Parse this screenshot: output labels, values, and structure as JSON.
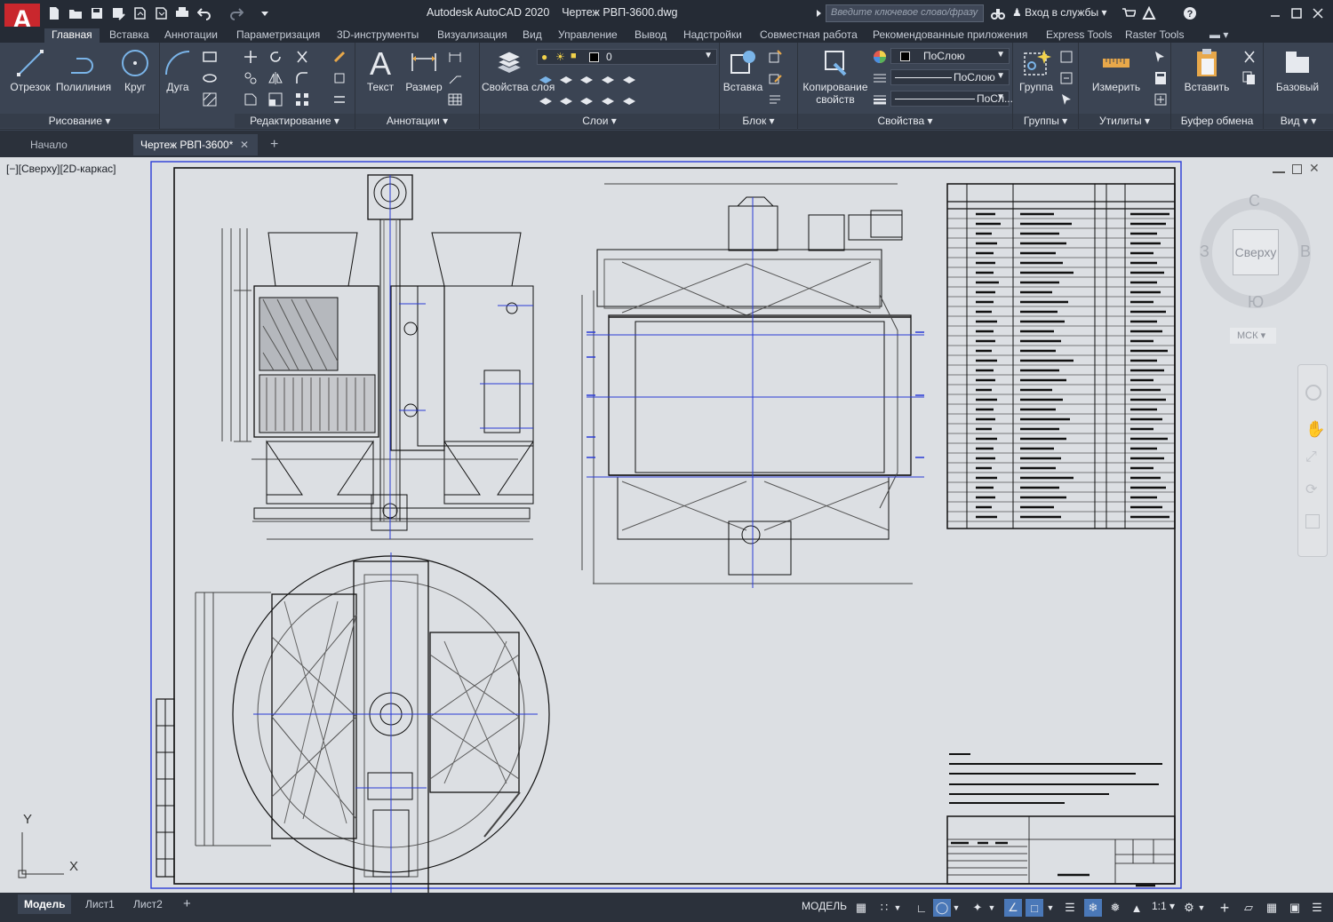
{
  "app": {
    "title": "Autodesk AutoCAD 2020",
    "drawing": "Чертеж РВП-3600.dwg",
    "logo_letter": "A"
  },
  "search": {
    "placeholder": "Введите ключевое слово/фразу"
  },
  "signin": "Вход в службы",
  "ribbon_tabs": [
    "Главная",
    "Вставка",
    "Аннотации",
    "Параметризация",
    "3D-инструменты",
    "Визуализация",
    "Вид",
    "Управление",
    "Вывод",
    "Надстройки",
    "Совместная работа",
    "Рекомендованные приложения",
    "Express Tools",
    "Raster Tools"
  ],
  "panels": {
    "draw": {
      "name": "Рисование",
      "tools": [
        "Отрезок",
        "Полилиния",
        "Круг",
        "Дуга"
      ]
    },
    "modify": {
      "name": "Редактирование"
    },
    "annotation": {
      "name": "Аннотации",
      "tools": [
        "Текст",
        "Размер"
      ]
    },
    "layers": {
      "name": "Слои",
      "tool": "Свойства слоя",
      "tool2": "слоя",
      "layer_value": "0"
    },
    "block": {
      "name": "Блок",
      "tool": "Вставка"
    },
    "properties": {
      "name": "Свойства",
      "tool": "Копирование",
      "tool2": "свойств",
      "color": "ПоСлою",
      "linetype": "ПоСлою",
      "lineweight": "ПоСл..."
    },
    "groups": {
      "name": "Группы",
      "tool": "Группа"
    },
    "utilities": {
      "name": "Утилиты",
      "tool": "Измерить"
    },
    "clipboard": {
      "name": "Буфер обмена",
      "tool": "Вставить"
    },
    "view": {
      "name": "Вид",
      "tool": "Базовый"
    }
  },
  "doc_tabs": {
    "start": "Начало",
    "active": "Чертеж РВП-3600*"
  },
  "viewport": {
    "label": "[−][Сверху][2D-каркас]",
    "viewcube": {
      "face": "Сверху",
      "north": "С",
      "south": "Ю",
      "west": "З",
      "east": "В",
      "ucs": "МСК"
    },
    "axis_y": "Y",
    "axis_x": "X"
  },
  "layout_tabs": [
    "Модель",
    "Лист1",
    "Лист2"
  ],
  "status": {
    "mode": "МОДЕЛЬ",
    "scale": "1:1"
  },
  "colors": {
    "accent": "#c9272d",
    "background": "#dcdfe3",
    "ribbon": "#3b4453"
  }
}
